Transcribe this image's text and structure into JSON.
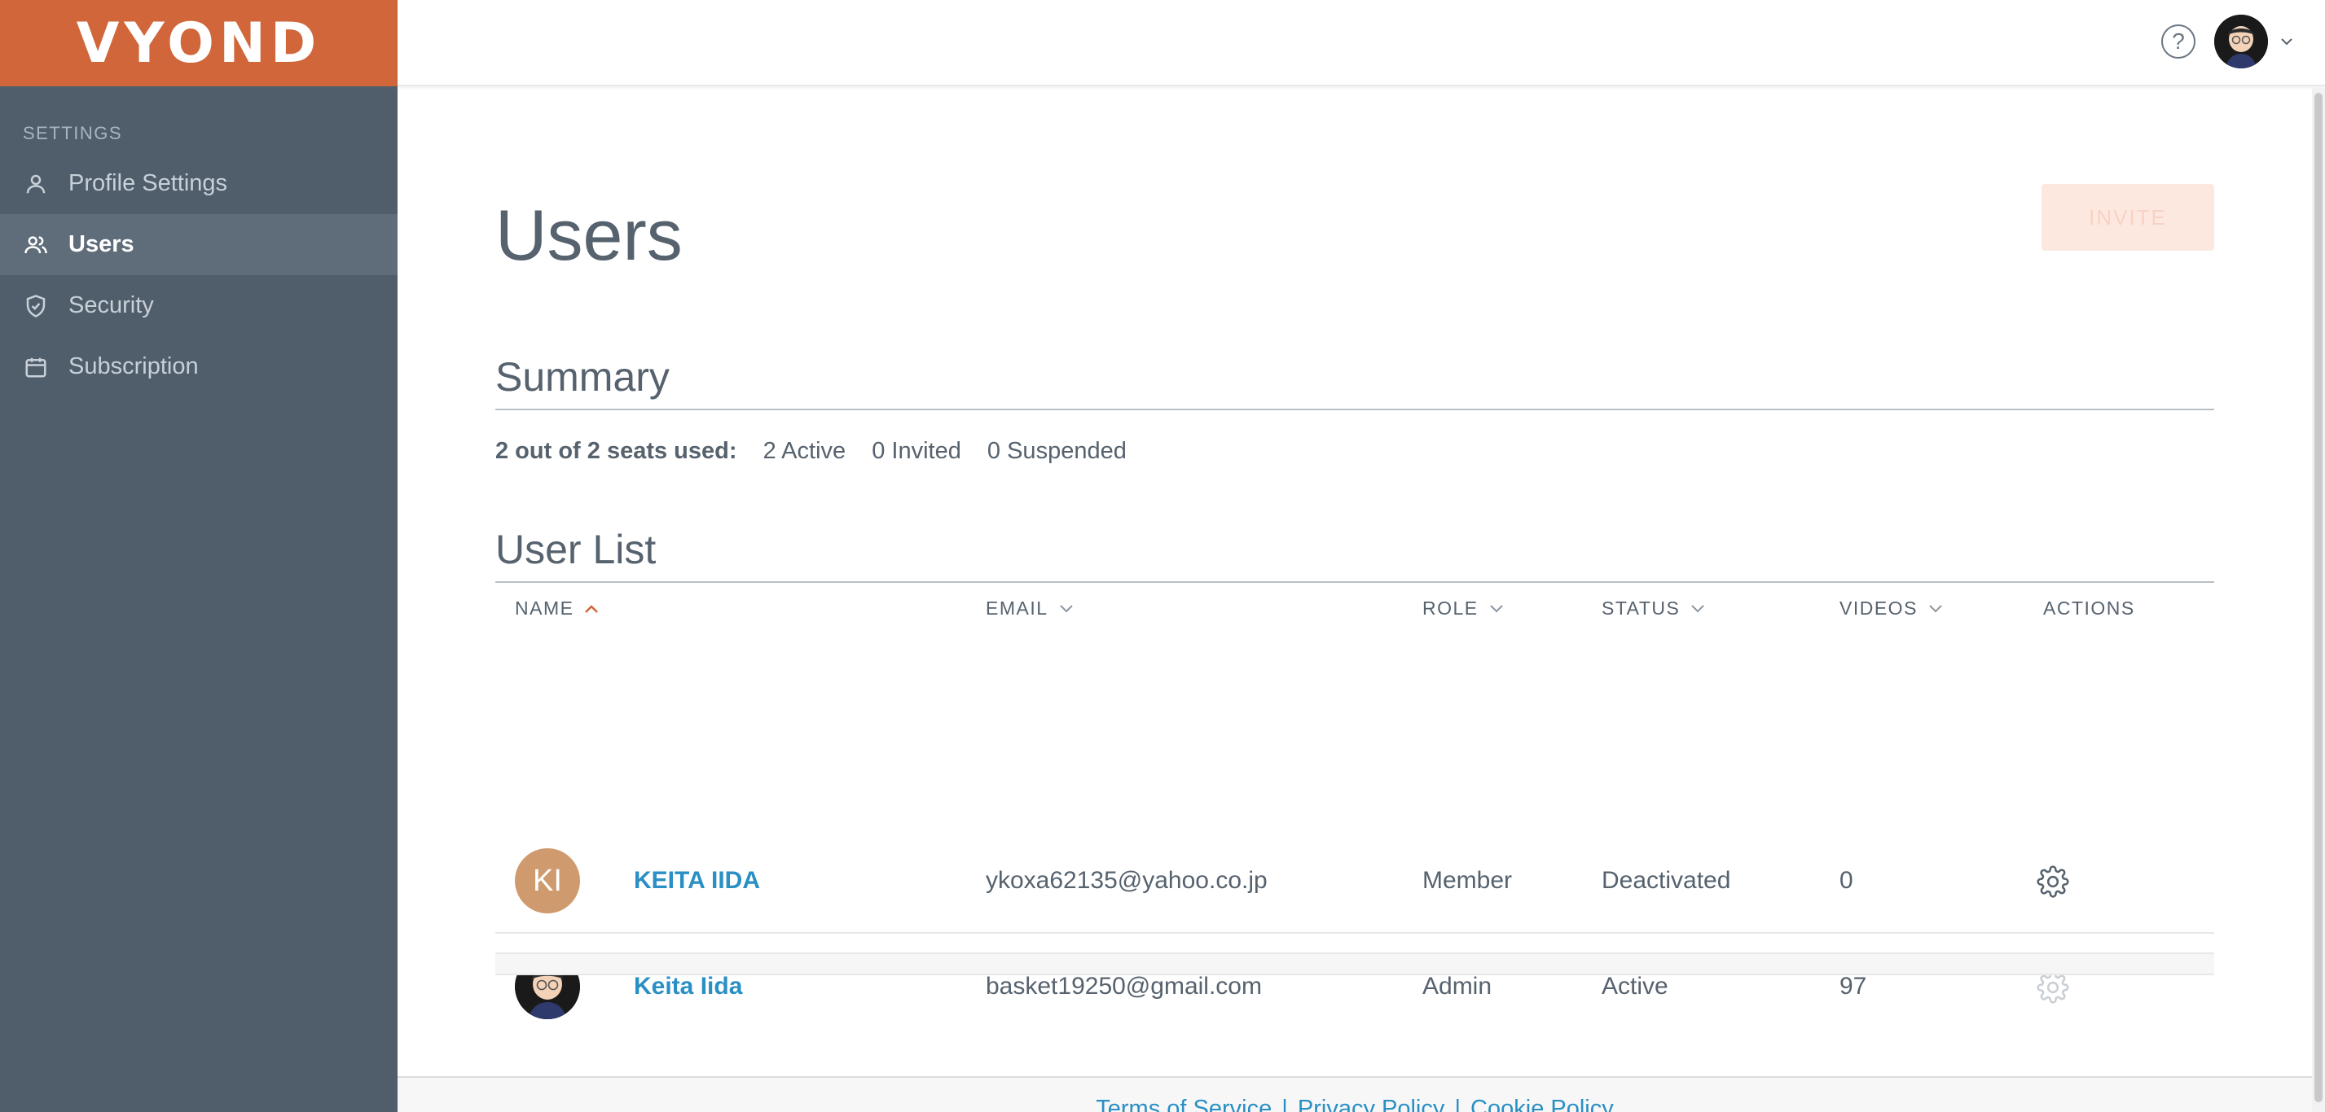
{
  "brand": {
    "logo_text": "VYOND",
    "colors": {
      "brand_orange": "#d0663a",
      "sidebar": "#505e6c",
      "link": "#2a8fc4"
    }
  },
  "sidebar": {
    "heading": "SETTINGS",
    "items": [
      {
        "label": "Profile Settings",
        "icon": "user-icon",
        "active": false
      },
      {
        "label": "Users",
        "icon": "users-icon",
        "active": true
      },
      {
        "label": "Security",
        "icon": "shield-icon",
        "active": false
      },
      {
        "label": "Subscription",
        "icon": "calendar-icon",
        "active": false
      }
    ]
  },
  "header": {
    "help": "?"
  },
  "page": {
    "title": "Users",
    "invite_label": "INVITE"
  },
  "summary": {
    "title": "Summary",
    "seats": "2 out of 2 seats used:",
    "active": "2 Active",
    "invited": "0 Invited",
    "suspended": "0 Suspended"
  },
  "user_list": {
    "title": "User List",
    "columns": [
      "NAME",
      "EMAIL",
      "ROLE",
      "STATUS",
      "VIDEOS",
      "ACTIONS"
    ],
    "rows": [
      {
        "initials": "KI",
        "name": "KEITA IIDA",
        "email": "ykoxa62135@yahoo.co.jp",
        "role": "Member",
        "status": "Deactivated",
        "videos": "0"
      },
      {
        "initials": "",
        "name": "Keita Iida",
        "email": "basket19250@gmail.com",
        "role": "Admin",
        "status": "Active",
        "videos": "97"
      }
    ]
  },
  "footer": {
    "terms": "Terms of Service",
    "privacy": "Privacy Policy",
    "cookie": "Cookie Policy",
    "separator": "|"
  }
}
